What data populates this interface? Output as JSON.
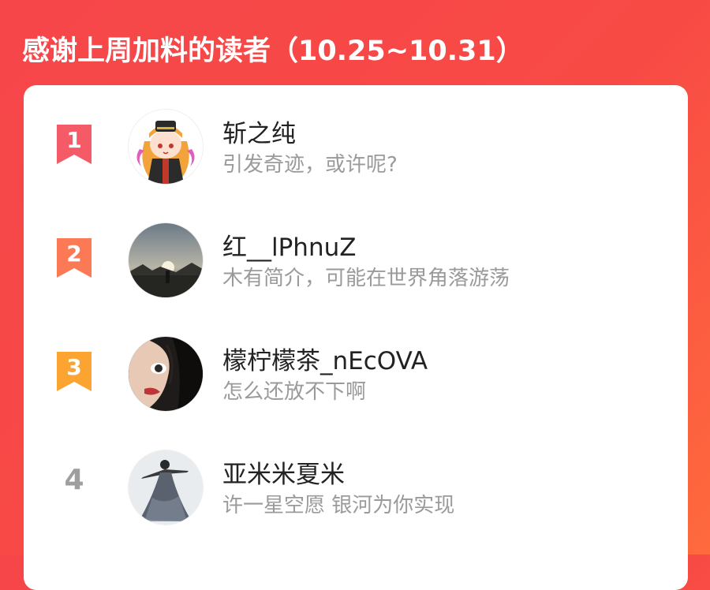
{
  "header": {
    "title": "感谢上周加料的读者（10.25~10.31）"
  },
  "readers": [
    {
      "rank": "1",
      "name": "斩之纯",
      "bio": "引发奇迹，或许呢?",
      "badge_color": "#f45b66",
      "avatar": "anime-girl-avatar"
    },
    {
      "rank": "2",
      "name": "红__lPhnuZ",
      "bio": "木有简介，可能在世界角落游荡",
      "badge_color": "#fb7a55",
      "avatar": "sunset-silhouette-avatar"
    },
    {
      "rank": "3",
      "name": "檬柠檬茶_nEcOVA",
      "bio": "怎么还放不下啊",
      "badge_color": "#fba431",
      "avatar": "girl-face-avatar"
    },
    {
      "rank": "4",
      "name": "亚米米夏米",
      "bio": "许一星空愿 银河为你实现",
      "badge_color": "#9e9e9e",
      "avatar": "dancer-avatar"
    }
  ],
  "colors": {
    "background": "#f6464a",
    "card": "#ffffff",
    "name_text": "#222222",
    "bio_text": "#9a9a9a"
  }
}
